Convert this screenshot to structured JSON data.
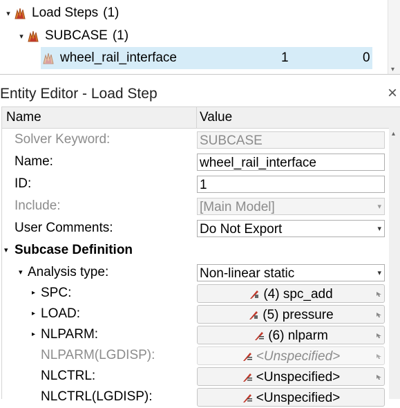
{
  "tree": {
    "items": [
      {
        "label": "Load Steps",
        "count": "(1)"
      },
      {
        "label": "SUBCASE",
        "count": "(1)"
      },
      {
        "label": "wheel_rail_interface",
        "col1": "1",
        "col2": "0"
      }
    ]
  },
  "editor": {
    "title": "Entity Editor - Load Step",
    "close": "×",
    "columns": {
      "name": "Name",
      "value": "Value"
    },
    "rows": {
      "solver_keyword": {
        "label": "Solver Keyword:",
        "value": "SUBCASE"
      },
      "name": {
        "label": "Name:",
        "value": "wheel_rail_interface"
      },
      "id": {
        "label": "ID:",
        "value": "1"
      },
      "include": {
        "label": "Include:",
        "value": "[Main Model]"
      },
      "user_comments": {
        "label": "User Comments:",
        "value": "Do Not Export"
      },
      "subcase_definition": {
        "label": "Subcase Definition"
      },
      "analysis_type": {
        "label": "Analysis type:",
        "value": "Non-linear static"
      },
      "spc": {
        "label": "SPC:",
        "value": "(4) spc_add"
      },
      "load": {
        "label": "LOAD:",
        "value": "(5) pressure"
      },
      "nlparm": {
        "label": "NLPARM:",
        "value": "(6) nlparm"
      },
      "nlparm_lgdisp": {
        "label": "NLPARM(LGDISP):",
        "value": "<Unspecified>"
      },
      "nlctrl": {
        "label": "NLCTRL:",
        "value": "<Unspecified>"
      },
      "nlctrl_lgdisp": {
        "label": "NLCTRL(LGDISP):",
        "value": "<Unspecified>"
      }
    }
  },
  "colors": {
    "selection": "#d6ecf8",
    "icon_red": "#c0392b",
    "icon_orange": "#d9822b"
  }
}
